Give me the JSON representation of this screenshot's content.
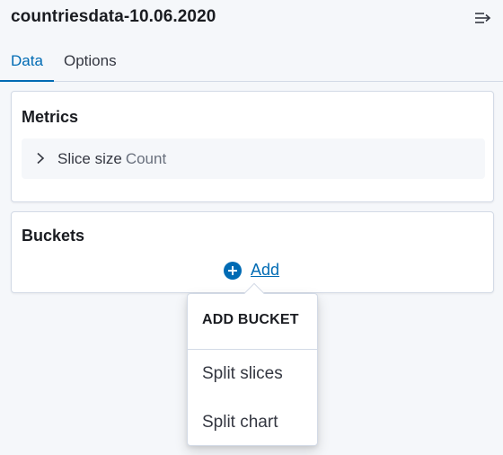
{
  "header": {
    "index_title": "countriesdata-10.06.2020",
    "collapse_icon": "menu-collapse-icon"
  },
  "tabs": [
    {
      "label": "Data",
      "active": true
    },
    {
      "label": "Options",
      "active": false
    }
  ],
  "metrics": {
    "title": "Metrics",
    "items": [
      {
        "label": "Slice size",
        "type": "Count",
        "expanded": false,
        "icon": "chevron-right-icon"
      }
    ]
  },
  "buckets": {
    "title": "Buckets",
    "add_label": "Add",
    "add_icon": "plus-in-circle-icon"
  },
  "add_bucket_menu": {
    "title": "ADD BUCKET",
    "items": [
      "Split slices",
      "Split chart"
    ]
  },
  "colors": {
    "accent": "#006bb4",
    "panel_bg": "#f5f7fa",
    "border": "#d3dae6",
    "text": "#1a1c21"
  }
}
